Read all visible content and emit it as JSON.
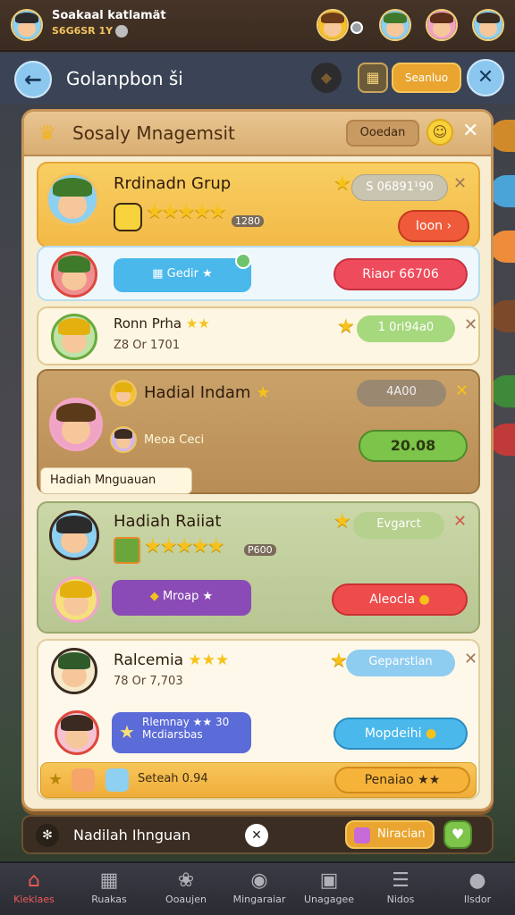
{
  "topbar": {
    "name": "Soakaal katlamät",
    "sub": "S6G6SR 1Y"
  },
  "header": {
    "title": "Golanpbon ši",
    "button_label": "Seanluo"
  },
  "panel": {
    "title": "Sosaly Mnagemsit",
    "tab_label": "Ooedan"
  },
  "cards": [
    {
      "name": "Rrdinadn Grup",
      "stars": "★★★★★",
      "stars_value": "1280",
      "pill": "S 06891¹90",
      "button": "Ioon ›"
    },
    {
      "tag": "Gedir",
      "button": "Riaor 66706"
    },
    {
      "name": "Ronn Prha",
      "name_stars": "★★",
      "sub": "Z8 Or 1701",
      "pill": "1 0ri94a0"
    },
    {
      "name": "Hadial Indam",
      "pill": "4A00",
      "sub_name": "Meoa Ceci",
      "value": "20.08",
      "footer": "Hadiah Mnguauan"
    },
    {
      "name": "Hadiah Raiiat",
      "stars": "★★★★★",
      "stars_value": "P600",
      "pill": "Evgarct",
      "tag": "Mroap",
      "button": "Aleocla"
    },
    {
      "name": "Ralcemia",
      "name_stars": "★★★",
      "sub": "78 Or 7,703",
      "pill": "Geparstian",
      "tag_line1": "Rlemnay ★★ 30",
      "tag_line2": "Mcdiarsbas",
      "button": "Mopdeihi",
      "footer_label": "Seteah 0.94",
      "footer_button": "Penaiao ★★"
    }
  ],
  "bottom": {
    "label": "Nadilah Ihnguan",
    "button": "Niracian"
  },
  "nav": [
    {
      "label": "Kieklaes",
      "icon": "home-icon"
    },
    {
      "label": "Ruakas",
      "icon": "gift-icon"
    },
    {
      "label": "Ooaujen",
      "icon": "bug-icon"
    },
    {
      "label": "Mingaraiar",
      "icon": "chat-icon"
    },
    {
      "label": "Unagagee",
      "icon": "chest-icon"
    },
    {
      "label": "Nidos",
      "icon": "list-icon"
    },
    {
      "label": "Ilsdor",
      "icon": "globe-icon"
    }
  ],
  "colors": {
    "accent_gold": "#f6c21a",
    "button_red": "#ee4c4c",
    "button_blue": "#4ab8ea",
    "button_green": "#7cc44a",
    "button_purple": "#8a4bb6",
    "nav_active": "#f05a5a"
  }
}
